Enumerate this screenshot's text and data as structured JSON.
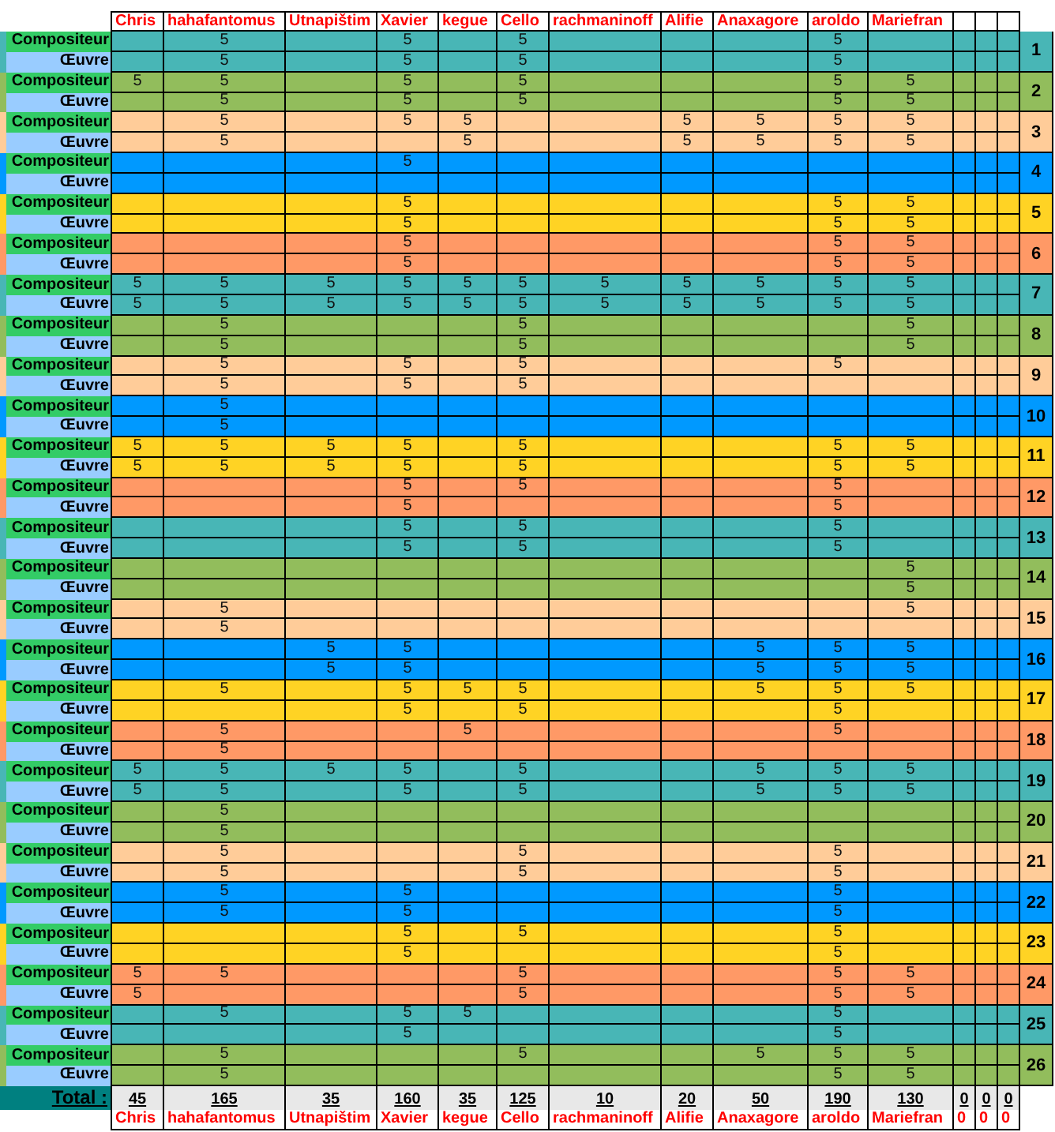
{
  "columns": [
    {
      "name": "Chris",
      "total": "45",
      "footer": "Chris"
    },
    {
      "name": "hahafantomus",
      "total": "165",
      "footer": "hahafantomus"
    },
    {
      "name": "Utnapištim",
      "total": "35",
      "footer": "Utnapištim"
    },
    {
      "name": "Xavier",
      "total": "160",
      "footer": "Xavier"
    },
    {
      "name": "kegue",
      "total": "35",
      "footer": "kegue"
    },
    {
      "name": "Cello",
      "total": "125",
      "footer": "Cello"
    },
    {
      "name": "rachmaninoff",
      "total": "10",
      "footer": "rachmaninoff"
    },
    {
      "name": "Alifie",
      "total": "20",
      "footer": "Alifie"
    },
    {
      "name": "Anaxagore",
      "total": "50",
      "footer": "Anaxagore"
    },
    {
      "name": "aroldo",
      "total": "190",
      "footer": "aroldo"
    },
    {
      "name": "Mariefran",
      "total": "130",
      "footer": "Mariefran"
    },
    {
      "total": "0",
      "footer": "0"
    },
    {
      "total": "0",
      "footer": "0"
    },
    {
      "total": "0",
      "footer": "0"
    }
  ],
  "total_label": "Total :",
  "groups": [
    {
      "number": "1",
      "color": "#48b6b6",
      "rows": [
        {
          "kind": "composer",
          "label": "Compositeur",
          "cells": [
            null,
            "5",
            null,
            "5",
            null,
            "5",
            null,
            null,
            null,
            "5",
            null,
            null,
            null,
            null
          ]
        },
        {
          "kind": "work",
          "label": "Œuvre",
          "cells": [
            null,
            "5",
            null,
            "5",
            null,
            "5",
            null,
            null,
            null,
            "5",
            null,
            null,
            null,
            null
          ]
        }
      ]
    },
    {
      "number": "2",
      "color": "#92bd5c",
      "rows": [
        {
          "kind": "composer",
          "label": "Compositeur",
          "cells": [
            "5",
            "5",
            null,
            "5",
            null,
            "5",
            null,
            null,
            null,
            "5",
            "5",
            null,
            null,
            null
          ]
        },
        {
          "kind": "work",
          "label": "Œuvre",
          "cells": [
            null,
            "5",
            null,
            "5",
            null,
            "5",
            null,
            null,
            null,
            "5",
            "5",
            null,
            null,
            null
          ]
        }
      ]
    },
    {
      "number": "3",
      "color": "#ffcc99",
      "rows": [
        {
          "kind": "composer",
          "label": "Compositeur",
          "cells": [
            null,
            "5",
            null,
            "5",
            "5",
            null,
            null,
            "5",
            "5",
            "5",
            "5",
            null,
            null,
            null
          ]
        },
        {
          "kind": "work",
          "label": "Œuvre",
          "cells": [
            null,
            "5",
            null,
            null,
            "5",
            null,
            null,
            "5",
            "5",
            "5",
            "5",
            null,
            null,
            null
          ]
        }
      ]
    },
    {
      "number": "4",
      "color": "#0099ff",
      "rows": [
        {
          "kind": "composer",
          "label": "Compositeur",
          "cells": [
            null,
            null,
            null,
            "5",
            null,
            null,
            null,
            null,
            null,
            null,
            null,
            null,
            null,
            null
          ]
        },
        {
          "kind": "work",
          "label": "Œuvre",
          "cells": [
            null,
            null,
            null,
            null,
            null,
            null,
            null,
            null,
            null,
            null,
            null,
            null,
            null,
            null
          ]
        }
      ]
    },
    {
      "number": "5",
      "color": "#ffd324",
      "rows": [
        {
          "kind": "composer",
          "label": "Compositeur",
          "cells": [
            null,
            null,
            null,
            "5",
            null,
            null,
            null,
            null,
            null,
            "5",
            "5",
            null,
            null,
            null
          ]
        },
        {
          "kind": "work",
          "label": "Œuvre",
          "cells": [
            null,
            null,
            null,
            "5",
            null,
            null,
            null,
            null,
            null,
            "5",
            "5",
            null,
            null,
            null
          ]
        }
      ]
    },
    {
      "number": "6",
      "color": "#ff9966",
      "rows": [
        {
          "kind": "composer",
          "label": "Compositeur",
          "cells": [
            null,
            null,
            null,
            "5",
            null,
            null,
            null,
            null,
            null,
            "5",
            "5",
            null,
            null,
            null
          ]
        },
        {
          "kind": "work",
          "label": "Œuvre",
          "cells": [
            null,
            null,
            null,
            "5",
            null,
            null,
            null,
            null,
            null,
            "5",
            "5",
            null,
            null,
            null
          ]
        }
      ]
    },
    {
      "number": "7",
      "color": "#48b6b6",
      "rows": [
        {
          "kind": "composer",
          "label": "Compositeur",
          "cells": [
            "5",
            "5",
            "5",
            "5",
            "5",
            "5",
            "5",
            "5",
            "5",
            "5",
            "5",
            null,
            null,
            null
          ]
        },
        {
          "kind": "work",
          "label": "Œuvre",
          "cells": [
            "5",
            "5",
            "5",
            "5",
            "5",
            "5",
            "5",
            "5",
            "5",
            "5",
            "5",
            null,
            null,
            null
          ]
        }
      ]
    },
    {
      "number": "8",
      "color": "#92bd5c",
      "rows": [
        {
          "kind": "composer",
          "label": "Compositeur",
          "cells": [
            null,
            "5",
            null,
            null,
            null,
            "5",
            null,
            null,
            null,
            null,
            "5",
            null,
            null,
            null
          ]
        },
        {
          "kind": "work",
          "label": "Œuvre",
          "cells": [
            null,
            "5",
            null,
            null,
            null,
            "5",
            null,
            null,
            null,
            null,
            "5",
            null,
            null,
            null
          ]
        }
      ]
    },
    {
      "number": "9",
      "color": "#ffcc99",
      "rows": [
        {
          "kind": "composer",
          "label": "Compositeur",
          "cells": [
            null,
            "5",
            null,
            "5",
            null,
            "5",
            null,
            null,
            null,
            "5",
            null,
            null,
            null,
            null
          ]
        },
        {
          "kind": "work",
          "label": "Œuvre",
          "cells": [
            null,
            "5",
            null,
            "5",
            null,
            "5",
            null,
            null,
            null,
            null,
            null,
            null,
            null,
            null
          ]
        }
      ]
    },
    {
      "number": "10",
      "color": "#0099ff",
      "rows": [
        {
          "kind": "composer",
          "label": "Compositeur",
          "cells": [
            null,
            "5",
            null,
            null,
            null,
            null,
            null,
            null,
            null,
            null,
            null,
            null,
            null,
            null
          ]
        },
        {
          "kind": "work",
          "label": "Œuvre",
          "cells": [
            null,
            "5",
            null,
            null,
            null,
            null,
            null,
            null,
            null,
            null,
            null,
            null,
            null,
            null
          ]
        }
      ]
    },
    {
      "number": "11",
      "color": "#ffd324",
      "rows": [
        {
          "kind": "composer",
          "label": "Compositeur",
          "cells": [
            "5",
            "5",
            "5",
            "5",
            null,
            "5",
            null,
            null,
            null,
            "5",
            "5",
            null,
            null,
            null
          ]
        },
        {
          "kind": "work",
          "label": "Œuvre",
          "cells": [
            "5",
            "5",
            "5",
            "5",
            null,
            "5",
            null,
            null,
            null,
            "5",
            "5",
            null,
            null,
            null
          ]
        }
      ]
    },
    {
      "number": "12",
      "color": "#ff9966",
      "rows": [
        {
          "kind": "composer",
          "label": "Compositeur",
          "cells": [
            null,
            null,
            null,
            "5",
            null,
            "5",
            null,
            null,
            null,
            "5",
            null,
            null,
            null,
            null
          ]
        },
        {
          "kind": "work",
          "label": "Œuvre",
          "cells": [
            null,
            null,
            null,
            "5",
            null,
            null,
            null,
            null,
            null,
            "5",
            null,
            null,
            null,
            null
          ]
        }
      ]
    },
    {
      "number": "13",
      "color": "#48b6b6",
      "rows": [
        {
          "kind": "composer",
          "label": "Compositeur",
          "cells": [
            null,
            null,
            null,
            "5",
            null,
            "5",
            null,
            null,
            null,
            "5",
            null,
            null,
            null,
            null
          ]
        },
        {
          "kind": "work",
          "label": "Œuvre",
          "cells": [
            null,
            null,
            null,
            "5",
            null,
            "5",
            null,
            null,
            null,
            "5",
            null,
            null,
            null,
            null
          ]
        }
      ]
    },
    {
      "number": "14",
      "color": "#92bd5c",
      "rows": [
        {
          "kind": "composer",
          "label": "Compositeur",
          "cells": [
            null,
            null,
            null,
            null,
            null,
            null,
            null,
            null,
            null,
            null,
            "5",
            null,
            null,
            null
          ]
        },
        {
          "kind": "work",
          "label": "Œuvre",
          "cells": [
            null,
            null,
            null,
            null,
            null,
            null,
            null,
            null,
            null,
            null,
            "5",
            null,
            null,
            null
          ]
        }
      ]
    },
    {
      "number": "15",
      "color": "#ffcc99",
      "rows": [
        {
          "kind": "composer",
          "label": "Compositeur",
          "cells": [
            null,
            "5",
            null,
            null,
            null,
            null,
            null,
            null,
            null,
            null,
            "5",
            null,
            null,
            null
          ]
        },
        {
          "kind": "work",
          "label": "Œuvre",
          "cells": [
            null,
            "5",
            null,
            null,
            null,
            null,
            null,
            null,
            null,
            null,
            null,
            null,
            null,
            null
          ]
        }
      ]
    },
    {
      "number": "16",
      "color": "#0099ff",
      "rows": [
        {
          "kind": "composer",
          "label": "Compositeur",
          "cells": [
            null,
            null,
            "5",
            "5",
            null,
            null,
            null,
            null,
            "5",
            "5",
            "5",
            null,
            null,
            null
          ]
        },
        {
          "kind": "work",
          "label": "Œuvre",
          "cells": [
            null,
            null,
            "5",
            "5",
            null,
            null,
            null,
            null,
            "5",
            "5",
            "5",
            null,
            null,
            null
          ]
        }
      ]
    },
    {
      "number": "17",
      "color": "#ffd324",
      "rows": [
        {
          "kind": "composer",
          "label": "Compositeur",
          "cells": [
            null,
            "5",
            null,
            "5",
            "5",
            "5",
            null,
            null,
            "5",
            "5",
            "5",
            null,
            null,
            null
          ]
        },
        {
          "kind": "work",
          "label": "Œuvre",
          "cells": [
            null,
            null,
            null,
            "5",
            null,
            "5",
            null,
            null,
            null,
            "5",
            null,
            null,
            null,
            null
          ]
        }
      ]
    },
    {
      "number": "18",
      "color": "#ff9966",
      "rows": [
        {
          "kind": "composer",
          "label": "Compositeur",
          "cells": [
            null,
            "5",
            null,
            null,
            "5",
            null,
            null,
            null,
            null,
            "5",
            null,
            null,
            null,
            null
          ]
        },
        {
          "kind": "work",
          "label": "Œuvre",
          "cells": [
            null,
            "5",
            null,
            null,
            null,
            null,
            null,
            null,
            null,
            null,
            null,
            null,
            null,
            null
          ]
        }
      ]
    },
    {
      "number": "19",
      "color": "#48b6b6",
      "rows": [
        {
          "kind": "composer",
          "label": "Compositeur",
          "cells": [
            "5",
            "5",
            "5",
            "5",
            null,
            "5",
            null,
            null,
            "5",
            "5",
            "5",
            null,
            null,
            null
          ]
        },
        {
          "kind": "work",
          "label": "Œuvre",
          "cells": [
            "5",
            "5",
            null,
            "5",
            null,
            "5",
            null,
            null,
            "5",
            "5",
            "5",
            null,
            null,
            null
          ]
        }
      ]
    },
    {
      "number": "20",
      "color": "#92bd5c",
      "rows": [
        {
          "kind": "composer",
          "label": "Compositeur",
          "cells": [
            null,
            "5",
            null,
            null,
            null,
            null,
            null,
            null,
            null,
            null,
            null,
            null,
            null,
            null
          ]
        },
        {
          "kind": "work",
          "label": "Œuvre",
          "cells": [
            null,
            "5",
            null,
            null,
            null,
            null,
            null,
            null,
            null,
            null,
            null,
            null,
            null,
            null
          ]
        }
      ]
    },
    {
      "number": "21",
      "color": "#ffcc99",
      "rows": [
        {
          "kind": "composer",
          "label": "Compositeur",
          "cells": [
            null,
            "5",
            null,
            null,
            null,
            "5",
            null,
            null,
            null,
            "5",
            null,
            null,
            null,
            null
          ]
        },
        {
          "kind": "work",
          "label": "Œuvre",
          "cells": [
            null,
            "5",
            null,
            null,
            null,
            "5",
            null,
            null,
            null,
            "5",
            null,
            null,
            null,
            null
          ]
        }
      ]
    },
    {
      "number": "22",
      "color": "#0099ff",
      "rows": [
        {
          "kind": "composer",
          "label": "Compositeur",
          "cells": [
            null,
            "5",
            null,
            "5",
            null,
            null,
            null,
            null,
            null,
            "5",
            null,
            null,
            null,
            null
          ]
        },
        {
          "kind": "work",
          "label": "Œuvre",
          "cells": [
            null,
            "5",
            null,
            "5",
            null,
            null,
            null,
            null,
            null,
            "5",
            null,
            null,
            null,
            null
          ]
        }
      ]
    },
    {
      "number": "23",
      "color": "#ffd324",
      "rows": [
        {
          "kind": "composer",
          "label": "Compositeur",
          "cells": [
            null,
            null,
            null,
            "5",
            null,
            "5",
            null,
            null,
            null,
            "5",
            null,
            null,
            null,
            null
          ]
        },
        {
          "kind": "work",
          "label": "Œuvre",
          "cells": [
            null,
            null,
            null,
            "5",
            null,
            null,
            null,
            null,
            null,
            "5",
            null,
            null,
            null,
            null
          ]
        }
      ]
    },
    {
      "number": "24",
      "color": "#ff9966",
      "rows": [
        {
          "kind": "composer",
          "label": "Compositeur",
          "cells": [
            "5",
            "5",
            null,
            null,
            null,
            "5",
            null,
            null,
            null,
            "5",
            "5",
            null,
            null,
            null
          ]
        },
        {
          "kind": "work",
          "label": "Œuvre",
          "cells": [
            "5",
            null,
            null,
            null,
            null,
            "5",
            null,
            null,
            null,
            "5",
            "5",
            null,
            null,
            null
          ]
        }
      ]
    },
    {
      "number": "25",
      "color": "#48b6b6",
      "rows": [
        {
          "kind": "composer",
          "label": "Compositeur",
          "cells": [
            null,
            "5",
            null,
            "5",
            "5",
            null,
            null,
            null,
            null,
            "5",
            null,
            null,
            null,
            null
          ]
        },
        {
          "kind": "work",
          "label": "Œuvre",
          "cells": [
            null,
            null,
            null,
            "5",
            null,
            null,
            null,
            null,
            null,
            "5",
            null,
            null,
            null,
            null
          ]
        }
      ]
    },
    {
      "number": "26",
      "color": "#92bd5c",
      "rows": [
        {
          "kind": "composer",
          "label": "Compositeur",
          "cells": [
            null,
            "5",
            null,
            null,
            null,
            "5",
            null,
            null,
            "5",
            "5",
            "5",
            null,
            null,
            null
          ]
        },
        {
          "kind": "work",
          "label": "Œuvre",
          "cells": [
            null,
            "5",
            null,
            null,
            null,
            null,
            null,
            null,
            null,
            "5",
            "5",
            null,
            null,
            null
          ]
        }
      ]
    }
  ]
}
